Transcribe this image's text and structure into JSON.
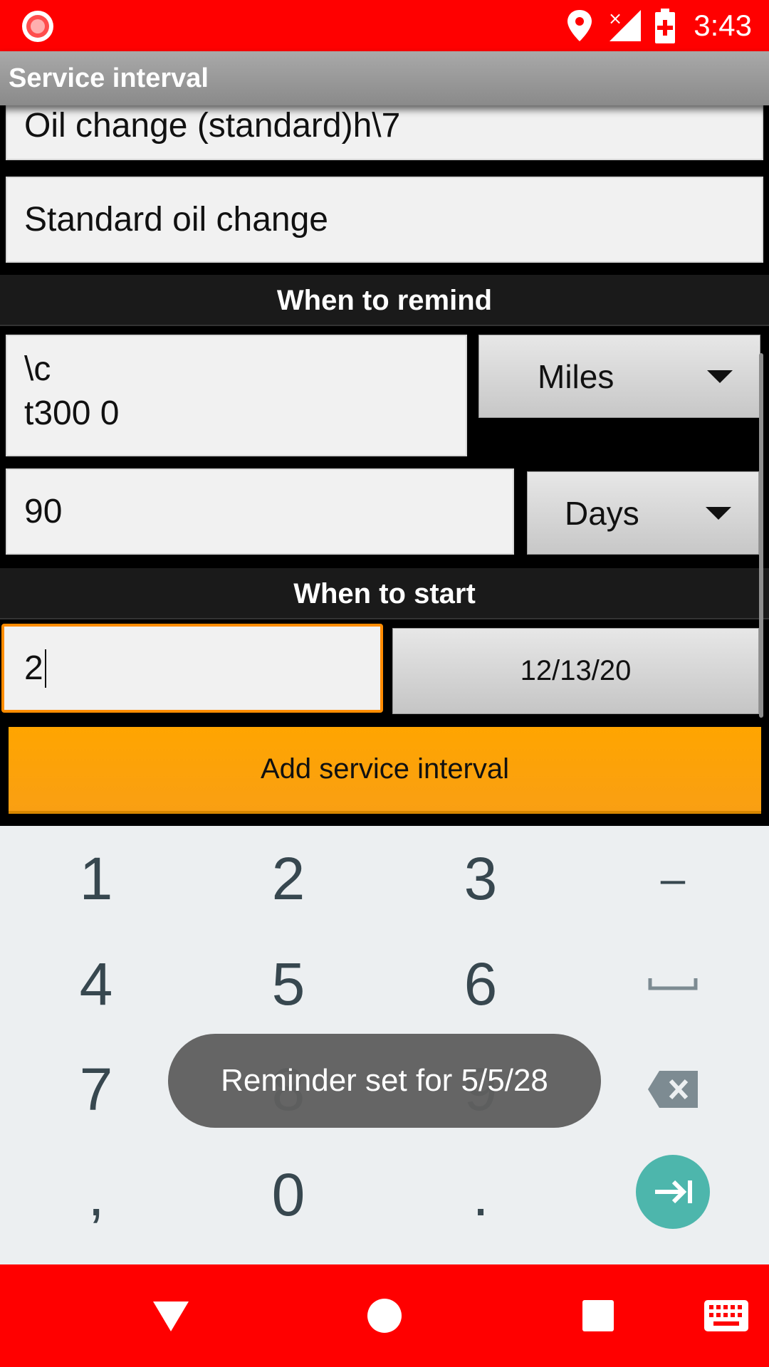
{
  "status_bar": {
    "time": "3:43",
    "icons": [
      "screen-record-icon",
      "location-pin-icon",
      "no-signal-icon",
      "battery-charging-icon"
    ],
    "color": "#ff0000"
  },
  "app": {
    "title": "Service interval"
  },
  "form": {
    "name_value": "Oil change (standard)h\\7",
    "description_value": "Standard oil change",
    "remind_header": "When to remind",
    "distance_value": "\\c\nt300 0",
    "distance_unit": "Miles",
    "time_value": "90",
    "time_unit": "Days",
    "start_header": "When to start",
    "start_value": "2",
    "start_date": "12/13/20",
    "submit_label": "Add service interval",
    "accent_color": "#ffa500"
  },
  "keyboard": {
    "rows": [
      [
        "1",
        "2",
        "3",
        "–"
      ],
      [
        "4",
        "5",
        "6",
        "space"
      ],
      [
        "7",
        "8",
        "9",
        "backspace"
      ],
      [
        ",",
        "0",
        ".",
        "enter"
      ]
    ],
    "enter_color": "#4db6ac"
  },
  "toast": {
    "message": "Reminder set for 5/5/28"
  },
  "nav_bar": {
    "buttons": [
      "back-icon",
      "home-icon",
      "recents-icon",
      "keyboard-icon"
    ]
  }
}
